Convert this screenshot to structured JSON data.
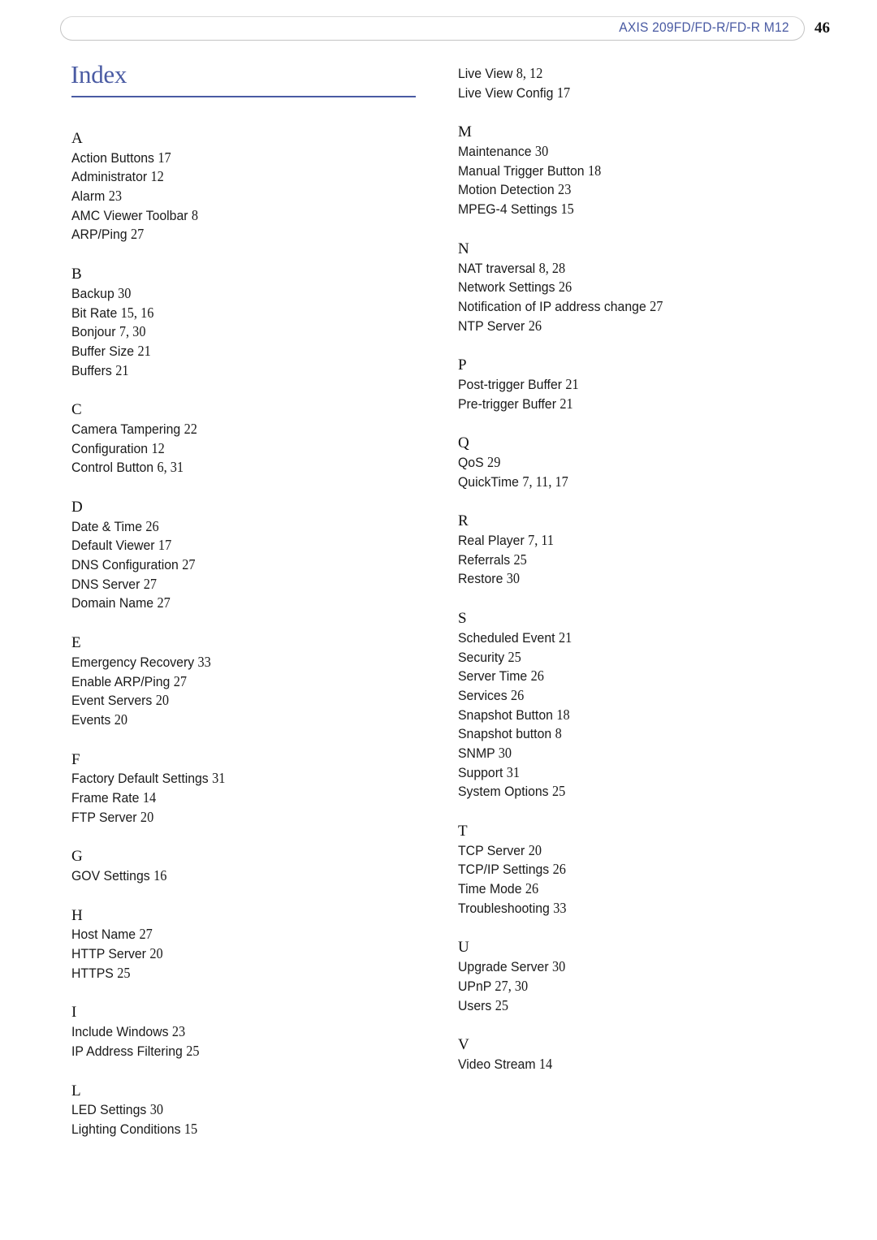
{
  "header": {
    "title": "AXIS 209FD/FD-R/FD-R M12",
    "page_number": "46"
  },
  "page_title": "Index",
  "colors": {
    "accent": "#4a5ba3",
    "text": "#1a1a1a",
    "header_border": "#c4c4c4"
  },
  "left_column": [
    {
      "letter": "A",
      "entries": [
        {
          "term": "Action Buttons",
          "pages": "17"
        },
        {
          "term": "Administrator",
          "pages": "12"
        },
        {
          "term": "Alarm",
          "pages": "23"
        },
        {
          "term": "AMC Viewer Toolbar",
          "pages": "8"
        },
        {
          "term": "ARP/Ping",
          "pages": "27"
        }
      ]
    },
    {
      "letter": "B",
      "entries": [
        {
          "term": "Backup",
          "pages": "30"
        },
        {
          "term": "Bit Rate",
          "pages": "15, 16"
        },
        {
          "term": "Bonjour",
          "pages": "7, 30"
        },
        {
          "term": "Buffer Size",
          "pages": "21"
        },
        {
          "term": "Buffers",
          "pages": "21"
        }
      ]
    },
    {
      "letter": "C",
      "entries": [
        {
          "term": "Camera Tampering",
          "pages": "22"
        },
        {
          "term": "Configuration",
          "pages": "12"
        },
        {
          "term": "Control Button",
          "pages": "6, 31"
        }
      ]
    },
    {
      "letter": "D",
      "entries": [
        {
          "term": "Date & Time",
          "pages": "26"
        },
        {
          "term": "Default Viewer",
          "pages": "17"
        },
        {
          "term": "DNS Configuration",
          "pages": "27"
        },
        {
          "term": "DNS Server",
          "pages": "27"
        },
        {
          "term": "Domain Name",
          "pages": "27"
        }
      ]
    },
    {
      "letter": "E",
      "entries": [
        {
          "term": "Emergency Recovery",
          "pages": "33"
        },
        {
          "term": "Enable ARP/Ping",
          "pages": "27"
        },
        {
          "term": "Event Servers",
          "pages": "20"
        },
        {
          "term": "Events",
          "pages": "20"
        }
      ]
    },
    {
      "letter": "F",
      "entries": [
        {
          "term": "Factory Default Settings",
          "pages": "31"
        },
        {
          "term": "Frame Rate",
          "pages": "14"
        },
        {
          "term": "FTP Server",
          "pages": "20"
        }
      ]
    },
    {
      "letter": "G",
      "entries": [
        {
          "term": "GOV Settings",
          "pages": "16"
        }
      ]
    },
    {
      "letter": "H",
      "entries": [
        {
          "term": "Host Name",
          "pages": "27"
        },
        {
          "term": "HTTP Server",
          "pages": "20"
        },
        {
          "term": "HTTPS",
          "pages": "25"
        }
      ]
    },
    {
      "letter": "I",
      "entries": [
        {
          "term": "Include Windows",
          "pages": "23"
        },
        {
          "term": "IP Address Filtering",
          "pages": "25"
        }
      ]
    },
    {
      "letter": "L",
      "entries": [
        {
          "term": "LED Settings",
          "pages": "30"
        },
        {
          "term": "Lighting Conditions",
          "pages": "15"
        }
      ]
    }
  ],
  "right_column": [
    {
      "letter": "",
      "entries": [
        {
          "term": "Live View",
          "pages": "8, 12"
        },
        {
          "term": "Live View Config",
          "pages": "17"
        }
      ]
    },
    {
      "letter": "M",
      "entries": [
        {
          "term": "Maintenance",
          "pages": "30"
        },
        {
          "term": "Manual Trigger Button",
          "pages": "18"
        },
        {
          "term": "Motion Detection",
          "pages": "23"
        },
        {
          "term": "MPEG-4 Settings",
          "pages": "15"
        }
      ]
    },
    {
      "letter": "N",
      "entries": [
        {
          "term": "NAT traversal",
          "pages": "8, 28"
        },
        {
          "term": "Network Settings",
          "pages": "26"
        },
        {
          "term": "Notification of IP address change",
          "pages": "27"
        },
        {
          "term": "NTP Server",
          "pages": "26"
        }
      ]
    },
    {
      "letter": "P",
      "entries": [
        {
          "term": "Post-trigger Buffer",
          "pages": "21"
        },
        {
          "term": "Pre-trigger Buffer",
          "pages": "21"
        }
      ]
    },
    {
      "letter": "Q",
      "entries": [
        {
          "term": "QoS",
          "pages": "29"
        },
        {
          "term": "QuickTime",
          "pages": "7, 11, 17"
        }
      ]
    },
    {
      "letter": "R",
      "entries": [
        {
          "term": "Real Player",
          "pages": "7, 11"
        },
        {
          "term": "Referrals",
          "pages": "25"
        },
        {
          "term": "Restore",
          "pages": "30"
        }
      ]
    },
    {
      "letter": "S",
      "entries": [
        {
          "term": "Scheduled Event",
          "pages": "21"
        },
        {
          "term": "Security",
          "pages": "25"
        },
        {
          "term": "Server Time",
          "pages": "26"
        },
        {
          "term": "Services",
          "pages": "26"
        },
        {
          "term": "Snapshot Button",
          "pages": "18"
        },
        {
          "term": "Snapshot button",
          "pages": "8"
        },
        {
          "term": "SNMP",
          "pages": "30"
        },
        {
          "term": "Support",
          "pages": "31"
        },
        {
          "term": "System Options",
          "pages": "25"
        }
      ]
    },
    {
      "letter": "T",
      "entries": [
        {
          "term": "TCP Server",
          "pages": "20"
        },
        {
          "term": "TCP/IP Settings",
          "pages": "26"
        },
        {
          "term": "Time Mode",
          "pages": "26"
        },
        {
          "term": "Troubleshooting",
          "pages": "33"
        }
      ]
    },
    {
      "letter": "U",
      "entries": [
        {
          "term": "Upgrade Server",
          "pages": "30"
        },
        {
          "term": "UPnP",
          "pages": "27, 30"
        },
        {
          "term": "Users",
          "pages": "25"
        }
      ]
    },
    {
      "letter": "V",
      "entries": [
        {
          "term": "Video Stream",
          "pages": "14"
        }
      ]
    }
  ]
}
